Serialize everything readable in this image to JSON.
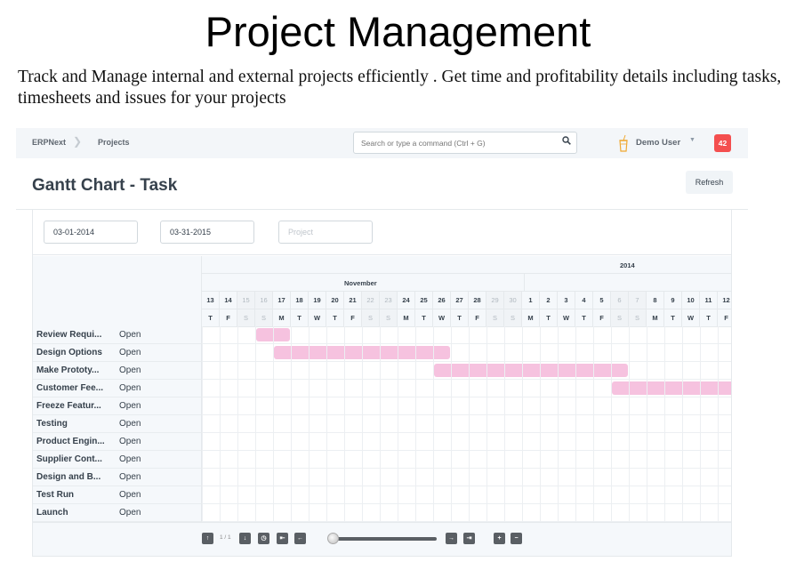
{
  "slide": {
    "title": "Project Management",
    "description": "Track and Manage internal and external projects efficiently . Get time and profitability details including tasks, timesheets and issues  for your projects"
  },
  "navbar": {
    "brand": "ERPNext",
    "breadcrumb": "Projects",
    "search_placeholder": "Search or type a command (Ctrl + G)",
    "user_name": "Demo User",
    "notification_count": "42"
  },
  "page": {
    "title": "Gantt Chart - Task",
    "refresh_label": "Refresh"
  },
  "filters": {
    "from_date": "03-01-2014",
    "to_date": "03-31-2015",
    "project_placeholder": "Project"
  },
  "timeline": {
    "year": "2014",
    "month": "November",
    "days": [
      {
        "d": "13",
        "w": "T",
        "weekend": false
      },
      {
        "d": "14",
        "w": "F",
        "weekend": false
      },
      {
        "d": "15",
        "w": "S",
        "weekend": true
      },
      {
        "d": "16",
        "w": "S",
        "weekend": true
      },
      {
        "d": "17",
        "w": "M",
        "weekend": false
      },
      {
        "d": "18",
        "w": "T",
        "weekend": false
      },
      {
        "d": "19",
        "w": "W",
        "weekend": false
      },
      {
        "d": "20",
        "w": "T",
        "weekend": false
      },
      {
        "d": "21",
        "w": "F",
        "weekend": false
      },
      {
        "d": "22",
        "w": "S",
        "weekend": true
      },
      {
        "d": "23",
        "w": "S",
        "weekend": true
      },
      {
        "d": "24",
        "w": "M",
        "weekend": false
      },
      {
        "d": "25",
        "w": "T",
        "weekend": false
      },
      {
        "d": "26",
        "w": "W",
        "weekend": false
      },
      {
        "d": "27",
        "w": "T",
        "weekend": false
      },
      {
        "d": "28",
        "w": "F",
        "weekend": false
      },
      {
        "d": "29",
        "w": "S",
        "weekend": true
      },
      {
        "d": "30",
        "w": "S",
        "weekend": true
      },
      {
        "d": "1",
        "w": "M",
        "weekend": false
      },
      {
        "d": "2",
        "w": "T",
        "weekend": false
      },
      {
        "d": "3",
        "w": "W",
        "weekend": false
      },
      {
        "d": "4",
        "w": "T",
        "weekend": false
      },
      {
        "d": "5",
        "w": "F",
        "weekend": false
      },
      {
        "d": "6",
        "w": "S",
        "weekend": true
      },
      {
        "d": "7",
        "w": "S",
        "weekend": true
      },
      {
        "d": "8",
        "w": "M",
        "weekend": false
      },
      {
        "d": "9",
        "w": "T",
        "weekend": false
      },
      {
        "d": "10",
        "w": "W",
        "weekend": false
      },
      {
        "d": "11",
        "w": "T",
        "weekend": false
      },
      {
        "d": "12",
        "w": "F",
        "weekend": false
      }
    ]
  },
  "tasks": [
    {
      "name": "Review Requi...",
      "status": "Open",
      "start_index": 3,
      "end_index": 4
    },
    {
      "name": "Design Options",
      "status": "Open",
      "start_index": 4,
      "end_index": 13
    },
    {
      "name": "Make Prototy...",
      "status": "Open",
      "start_index": 13,
      "end_index": 23
    },
    {
      "name": "Customer Fee...",
      "status": "Open",
      "start_index": 23,
      "end_index": 30
    },
    {
      "name": "Freeze Featur...",
      "status": "Open"
    },
    {
      "name": "Testing",
      "status": "Open"
    },
    {
      "name": "Product Engin...",
      "status": "Open"
    },
    {
      "name": "Supplier Cont...",
      "status": "Open"
    },
    {
      "name": "Design and B...",
      "status": "Open"
    },
    {
      "name": "Test Run",
      "status": "Open"
    },
    {
      "name": "Launch",
      "status": "Open"
    }
  ],
  "footer": {
    "page_indicator": "1 / 1",
    "zoom_level": 0.05
  },
  "colors": {
    "bar": "#f6c2df",
    "badge": "#f44f4f",
    "user_icon": "#f0a830"
  }
}
